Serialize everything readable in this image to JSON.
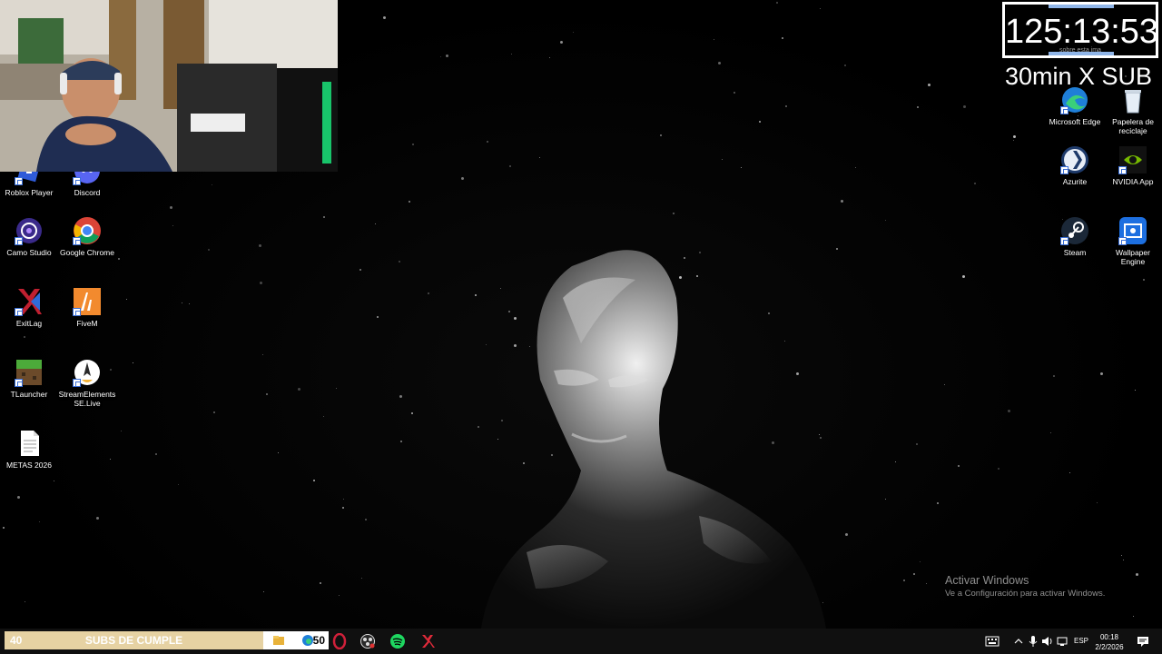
{
  "timer": {
    "value": "125:13:53",
    "caption": "sobre esta ima",
    "subtitle": "30min X SUB"
  },
  "desktop_icons_left": [
    {
      "label": "Roblox Player",
      "icon": "roblox-icon"
    },
    {
      "label": "Discord",
      "icon": "discord-icon"
    },
    {
      "label": "Camo Studio",
      "icon": "camo-icon"
    },
    {
      "label": "Google Chrome",
      "icon": "chrome-icon"
    },
    {
      "label": "ExitLag",
      "icon": "exitlag-icon"
    },
    {
      "label": "FiveM",
      "icon": "fivem-icon"
    },
    {
      "label": "TLauncher",
      "icon": "tlauncher-icon"
    },
    {
      "label": "StreamElements SE.Live",
      "icon": "streamelements-icon"
    },
    {
      "label": "METAS 2026",
      "icon": "text-file-icon"
    }
  ],
  "desktop_icons_right": [
    {
      "label": "Microsoft Edge",
      "icon": "edge-icon"
    },
    {
      "label": "Papelera de reciclaje",
      "icon": "recycle-bin-icon"
    },
    {
      "label": "Azurite",
      "icon": "azurite-icon"
    },
    {
      "label": "NVIDIA App",
      "icon": "nvidia-icon"
    },
    {
      "label": "Steam",
      "icon": "steam-icon"
    },
    {
      "label": "Wallpaper Engine",
      "icon": "wallpaper-engine-icon"
    }
  ],
  "watermark": {
    "title": "Activar Windows",
    "subtitle": "Ve a Configuración para activar Windows."
  },
  "sub_goal": {
    "count": "40",
    "label": "SUBS DE CUMPLE",
    "counter": "50"
  },
  "tray": {
    "language": "ESP",
    "time": "00:18",
    "date": "2/2/2026"
  },
  "colors": {
    "goal_bar": "#e6d2a3",
    "taskbar": "#101010",
    "timer_accent": "#8fb5e8"
  }
}
